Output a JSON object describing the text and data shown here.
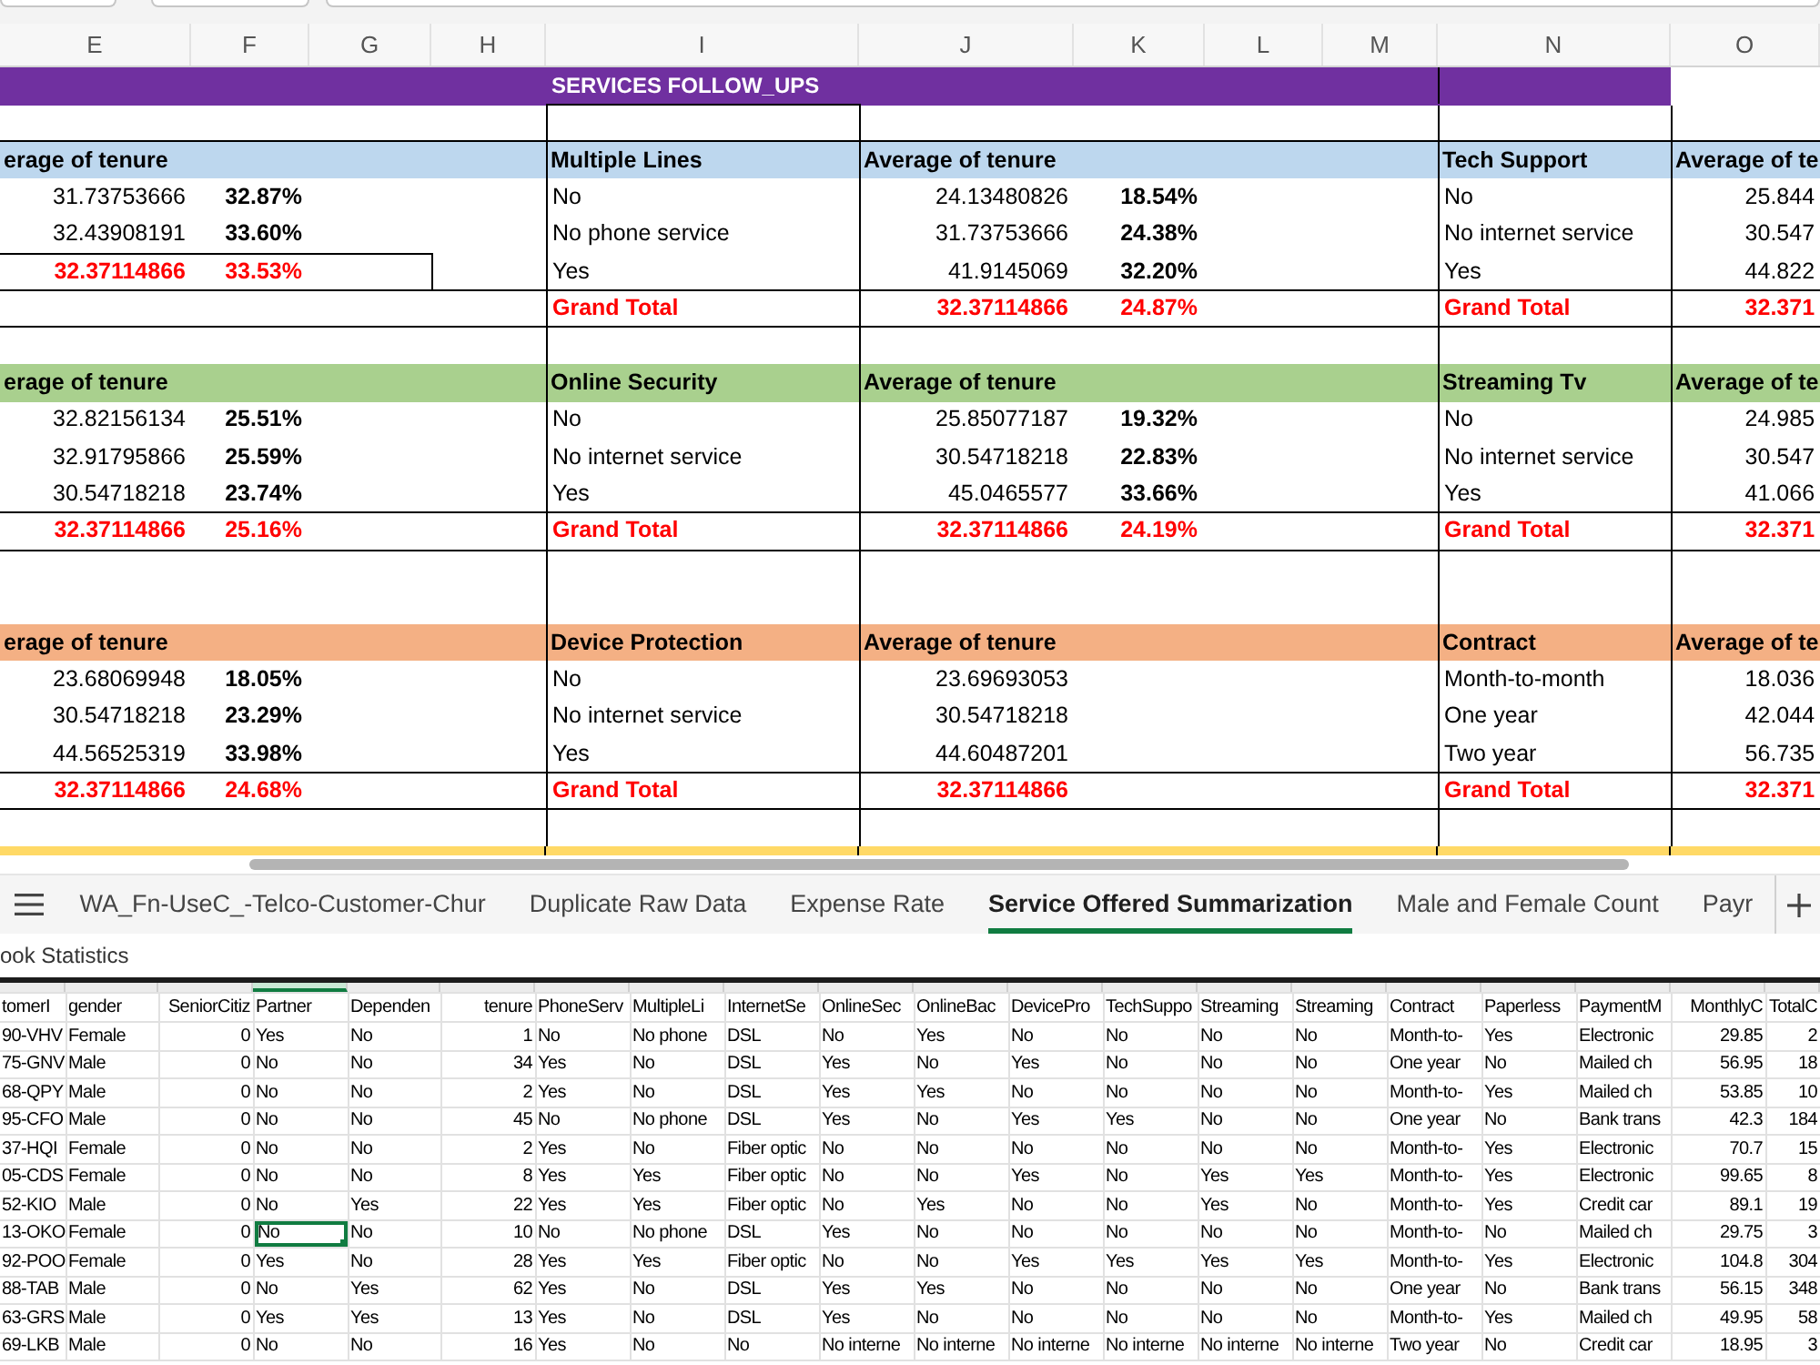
{
  "column_letters": [
    "E",
    "F",
    "G",
    "H",
    "I",
    "J",
    "K",
    "L",
    "M",
    "N",
    "O"
  ],
  "title": "SERVICES FOLLOW_UPS",
  "bands": [
    {
      "color": "#bdd7ee",
      "left": {
        "header": "erage of tenure",
        "rows": [
          {
            "average": "31.73753666",
            "percent": "32.87%"
          },
          {
            "average": "32.43908191",
            "percent": "33.60%"
          }
        ],
        "total": {
          "average": "32.37114866",
          "percent": "33.53%"
        }
      },
      "middle": {
        "category_header": "Multiple Lines",
        "value_header": "Average of tenure",
        "rows": [
          {
            "label": "No",
            "average": "24.13480826",
            "percent": "18.54%"
          },
          {
            "label": "No phone service",
            "average": "31.73753666",
            "percent": "24.38%"
          },
          {
            "label": "Yes",
            "average": "41.9145069",
            "percent": "32.20%"
          }
        ],
        "total": {
          "label": "Grand Total",
          "average": "32.37114866",
          "percent": "24.87%"
        }
      },
      "right": {
        "category_header": "Tech Support",
        "value_header": "Average of te",
        "rows": [
          {
            "label": "No",
            "average": "25.844"
          },
          {
            "label": "No internet service",
            "average": "30.547"
          },
          {
            "label": "Yes",
            "average": "44.822"
          }
        ],
        "total": {
          "label": "Grand Total",
          "average": "32.371"
        }
      }
    },
    {
      "color": "#a9d08e",
      "left": {
        "header": "erage of tenure",
        "rows": [
          {
            "average": "32.82156134",
            "percent": "25.51%"
          },
          {
            "average": "32.91795866",
            "percent": "25.59%"
          },
          {
            "average": "30.54718218",
            "percent": "23.74%"
          }
        ],
        "total": {
          "average": "32.37114866",
          "percent": "25.16%"
        }
      },
      "middle": {
        "category_header": "Online Security",
        "value_header": "Average of tenure",
        "rows": [
          {
            "label": "No",
            "average": "25.85077187",
            "percent": "19.32%"
          },
          {
            "label": "No internet service",
            "average": "30.54718218",
            "percent": "22.83%"
          },
          {
            "label": "Yes",
            "average": "45.0465577",
            "percent": "33.66%"
          }
        ],
        "total": {
          "label": "Grand Total",
          "average": "32.37114866",
          "percent": "24.19%"
        }
      },
      "right": {
        "category_header": "Streaming Tv",
        "value_header": "Average of te",
        "rows": [
          {
            "label": "No",
            "average": "24.985"
          },
          {
            "label": "No internet service",
            "average": "30.547"
          },
          {
            "label": "Yes",
            "average": "41.066"
          }
        ],
        "total": {
          "label": "Grand Total",
          "average": "32.371"
        }
      }
    },
    {
      "color": "#f4b084",
      "left": {
        "header": "erage of tenure",
        "rows": [
          {
            "average": "23.68069948",
            "percent": "18.05%"
          },
          {
            "average": "30.54718218",
            "percent": "23.29%"
          },
          {
            "average": "44.56525319",
            "percent": "33.98%"
          }
        ],
        "total": {
          "average": "32.37114866",
          "percent": "24.68%"
        }
      },
      "middle": {
        "category_header": "Device Protection",
        "value_header": "Average of tenure",
        "rows": [
          {
            "label": "No",
            "average": "23.69693053"
          },
          {
            "label": "No internet service",
            "average": "30.54718218"
          },
          {
            "label": "Yes",
            "average": "44.60487201"
          }
        ],
        "total": {
          "label": "Grand Total",
          "average": "32.37114866"
        }
      },
      "right": {
        "category_header": "Contract",
        "value_header": "Average of te",
        "rows": [
          {
            "label": "Month-to-month",
            "average": "18.036"
          },
          {
            "label": "One year",
            "average": "42.044"
          },
          {
            "label": "Two year",
            "average": "56.735"
          }
        ],
        "total": {
          "label": "Grand Total",
          "average": "32.371"
        }
      }
    }
  ],
  "sheet_tabs": [
    {
      "label": "WA_Fn-UseC_-Telco-Customer-Chur",
      "selected": false
    },
    {
      "label": "Duplicate Raw Data",
      "selected": false
    },
    {
      "label": "Expense Rate",
      "selected": false
    },
    {
      "label": "Service Offered Summarization",
      "selected": true
    },
    {
      "label": "Male and Female Count",
      "selected": false
    },
    {
      "label": "Payr",
      "selected": false
    }
  ],
  "status_bar": {
    "label": "ook Statistics"
  },
  "data_sheet": {
    "columns": [
      {
        "label": "tomerI",
        "kind": "text",
        "selected": false
      },
      {
        "label": "gender",
        "kind": "text",
        "selected": false
      },
      {
        "label": "SeniorCitiz",
        "kind": "number",
        "selected": false
      },
      {
        "label": "Partner",
        "kind": "text",
        "selected": true
      },
      {
        "label": "Dependen",
        "kind": "text",
        "selected": false
      },
      {
        "label": "tenure",
        "kind": "number",
        "selected": false
      },
      {
        "label": "PhoneServ",
        "kind": "text",
        "selected": false
      },
      {
        "label": "MultipleLi",
        "kind": "text",
        "selected": false
      },
      {
        "label": "InternetSe",
        "kind": "text",
        "selected": false
      },
      {
        "label": "OnlineSec",
        "kind": "text",
        "selected": false
      },
      {
        "label": "OnlineBac",
        "kind": "text",
        "selected": false
      },
      {
        "label": "DevicePro",
        "kind": "text",
        "selected": false
      },
      {
        "label": "TechSuppo",
        "kind": "text",
        "selected": false
      },
      {
        "label": "Streaming",
        "kind": "text",
        "selected": false
      },
      {
        "label": "Streaming",
        "kind": "text",
        "selected": false
      },
      {
        "label": "Contract",
        "kind": "text",
        "selected": false
      },
      {
        "label": "Paperless",
        "kind": "text",
        "selected": false
      },
      {
        "label": "PaymentM",
        "kind": "text",
        "selected": false
      },
      {
        "label": "MonthlyC",
        "kind": "number",
        "selected": false
      },
      {
        "label": "TotalC",
        "kind": "number",
        "selected": false
      }
    ],
    "rows": [
      {
        "selected": false,
        "cells": [
          "90-VHV",
          "Female",
          "0",
          "Yes",
          "No",
          "1",
          "No",
          "No phone",
          "DSL",
          "No",
          "Yes",
          "No",
          "No",
          "No",
          "No",
          "Month-to-",
          "Yes",
          "Electronic",
          "29.85",
          "2"
        ]
      },
      {
        "selected": false,
        "cells": [
          "75-GNV",
          "Male",
          "0",
          "No",
          "No",
          "34",
          "Yes",
          "No",
          "DSL",
          "Yes",
          "No",
          "Yes",
          "No",
          "No",
          "No",
          "One year",
          "No",
          "Mailed ch",
          "56.95",
          "18"
        ]
      },
      {
        "selected": false,
        "cells": [
          "68-QPY",
          "Male",
          "0",
          "No",
          "No",
          "2",
          "Yes",
          "No",
          "DSL",
          "Yes",
          "Yes",
          "No",
          "No",
          "No",
          "No",
          "Month-to-",
          "Yes",
          "Mailed ch",
          "53.85",
          "10"
        ]
      },
      {
        "selected": false,
        "cells": [
          "95-CFO",
          "Male",
          "0",
          "No",
          "No",
          "45",
          "No",
          "No phone",
          "DSL",
          "Yes",
          "No",
          "Yes",
          "Yes",
          "No",
          "No",
          "One year",
          "No",
          "Bank trans",
          "42.3",
          "184"
        ]
      },
      {
        "selected": false,
        "cells": [
          "37-HQI",
          "Female",
          "0",
          "No",
          "No",
          "2",
          "Yes",
          "No",
          "Fiber optic",
          "No",
          "No",
          "No",
          "No",
          "No",
          "No",
          "Month-to-",
          "Yes",
          "Electronic",
          "70.7",
          "15"
        ]
      },
      {
        "selected": false,
        "cells": [
          "05-CDS",
          "Female",
          "0",
          "No",
          "No",
          "8",
          "Yes",
          "Yes",
          "Fiber optic",
          "No",
          "No",
          "Yes",
          "No",
          "Yes",
          "Yes",
          "Month-to-",
          "Yes",
          "Electronic",
          "99.65",
          "8"
        ]
      },
      {
        "selected": false,
        "cells": [
          "52-KIO",
          "Male",
          "0",
          "No",
          "Yes",
          "22",
          "Yes",
          "Yes",
          "Fiber optic",
          "No",
          "Yes",
          "No",
          "No",
          "Yes",
          "No",
          "Month-to-",
          "Yes",
          "Credit car",
          "89.1",
          "19"
        ]
      },
      {
        "selected": true,
        "cells": [
          "13-OKO",
          "Female",
          "0",
          "No",
          "No",
          "10",
          "No",
          "No phone",
          "DSL",
          "Yes",
          "No",
          "No",
          "No",
          "No",
          "No",
          "Month-to-",
          "No",
          "Mailed ch",
          "29.75",
          "3"
        ]
      },
      {
        "selected": false,
        "cells": [
          "92-POO",
          "Female",
          "0",
          "Yes",
          "No",
          "28",
          "Yes",
          "Yes",
          "Fiber optic",
          "No",
          "No",
          "Yes",
          "Yes",
          "Yes",
          "Yes",
          "Month-to-",
          "Yes",
          "Electronic",
          "104.8",
          "304"
        ]
      },
      {
        "selected": false,
        "cells": [
          "88-TAB",
          "Male",
          "0",
          "No",
          "Yes",
          "62",
          "Yes",
          "No",
          "DSL",
          "Yes",
          "Yes",
          "No",
          "No",
          "No",
          "No",
          "One year",
          "No",
          "Bank trans",
          "56.15",
          "348"
        ]
      },
      {
        "selected": false,
        "cells": [
          "63-GRS",
          "Male",
          "0",
          "Yes",
          "Yes",
          "13",
          "Yes",
          "No",
          "DSL",
          "Yes",
          "No",
          "No",
          "No",
          "No",
          "No",
          "Month-to-",
          "Yes",
          "Mailed ch",
          "49.95",
          "58"
        ]
      },
      {
        "selected": false,
        "cells": [
          "69-LKB",
          "Male",
          "0",
          "No",
          "No",
          "16",
          "Yes",
          "No",
          "No",
          "No interne",
          "No interne",
          "No interne",
          "No interne",
          "No interne",
          "No interne",
          "Two year",
          "No",
          "Credit car",
          "18.95",
          "3"
        ]
      }
    ]
  }
}
